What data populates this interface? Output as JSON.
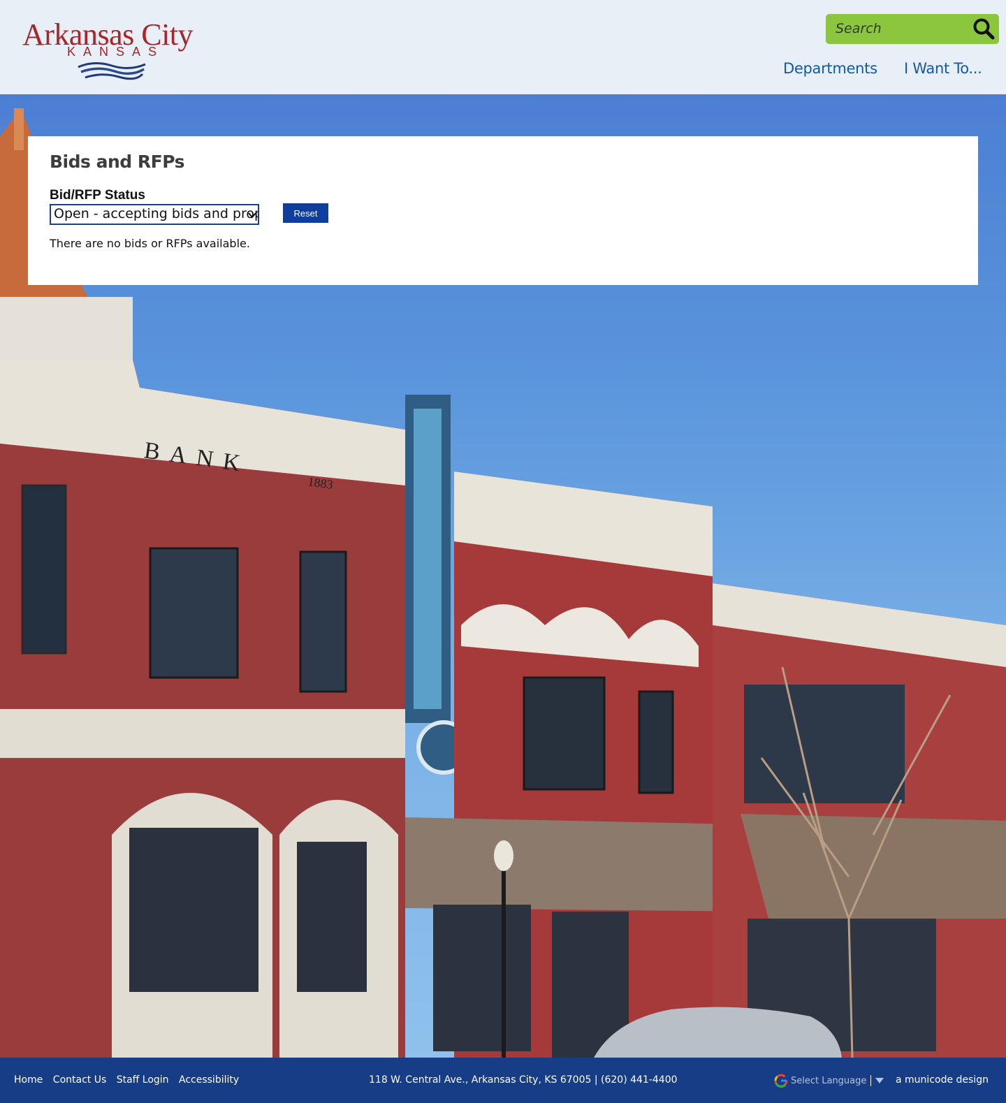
{
  "header": {
    "logo": {
      "name": "Arkansas City",
      "subtitle": "KANSAS"
    },
    "search": {
      "placeholder": "Search"
    },
    "nav": [
      {
        "label": "Departments"
      },
      {
        "label": "I Want To..."
      }
    ]
  },
  "main": {
    "title": "Bids and RFPs",
    "filter": {
      "label": "Bid/RFP Status",
      "selected": "Open - accepting bids and proposals"
    },
    "reset_label": "Reset",
    "empty_message": "There are no bids or RFPs available."
  },
  "footer": {
    "links": [
      "Home",
      "Contact Us",
      "Staff Login",
      "Accessibility"
    ],
    "address": "118 W. Central Ave., Arkansas City, KS 67005 | (620) 441-4400",
    "translate_label": "Select Language",
    "credit": "a municode design"
  },
  "colors": {
    "brand_red": "#a5262b",
    "nav_blue": "#1557a8",
    "search_green": "#8cc63f",
    "button_blue": "#0d3ea0",
    "footer_blue": "#163d85"
  },
  "icons": [
    "search-icon",
    "chevron-down-icon",
    "google-icon",
    "caret-down-icon",
    "wave-logo-icon"
  ]
}
